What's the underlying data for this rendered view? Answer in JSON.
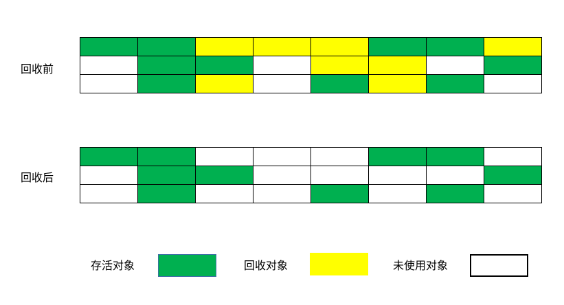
{
  "colors": {
    "live": "#00b050",
    "recycled": "#ffff00",
    "unused": "#ffffff"
  },
  "before": {
    "label": "回收前",
    "rows": [
      [
        "live",
        "live",
        "recycled",
        "recycled",
        "recycled",
        "live",
        "live",
        "recycled"
      ],
      [
        "unused",
        "live",
        "live",
        "unused",
        "recycled",
        "recycled",
        "unused",
        "live"
      ],
      [
        "unused",
        "live",
        "recycled",
        "unused",
        "live",
        "recycled",
        "live",
        "unused"
      ]
    ]
  },
  "after": {
    "label": "回收后",
    "rows": [
      [
        "live",
        "live",
        "unused",
        "unused",
        "unused",
        "live",
        "live",
        "unused"
      ],
      [
        "unused",
        "live",
        "live",
        "unused",
        "unused",
        "unused",
        "unused",
        "live"
      ],
      [
        "unused",
        "live",
        "unused",
        "unused",
        "live",
        "unused",
        "live",
        "unused"
      ]
    ]
  },
  "legend": {
    "live": "存活对象",
    "recycled": "回收对象",
    "unused": "未使用对象"
  }
}
